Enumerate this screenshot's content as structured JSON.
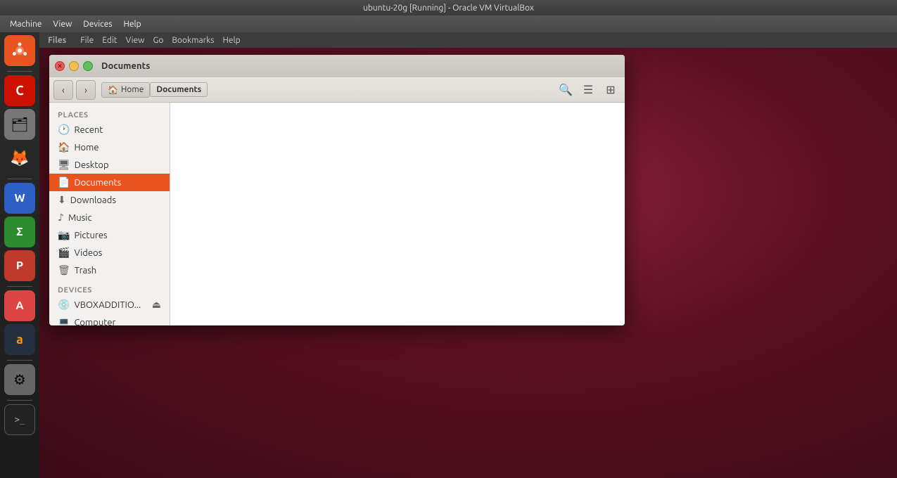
{
  "vbox": {
    "title": "ubuntu-20g [Running] - Oracle VM VirtualBox",
    "menus": [
      "Machine",
      "View",
      "Devices",
      "Help"
    ]
  },
  "files_topbar": {
    "menus": [
      "File",
      "Edit",
      "View",
      "Go",
      "Bookmarks",
      "Help"
    ],
    "left_label": "Files"
  },
  "filemanager": {
    "title": "Documents",
    "toolbar": {
      "back_label": "‹",
      "forward_label": "›",
      "breadcrumb": [
        {
          "label": "Home",
          "icon": "🏠",
          "active": false
        },
        {
          "label": "Documents",
          "icon": "",
          "active": true
        }
      ],
      "search_icon": "🔍",
      "list_icon": "☰",
      "grid_icon": "⋮⋮"
    },
    "sidebar": {
      "places_label": "Places",
      "devices_label": "Devices",
      "places_items": [
        {
          "id": "recent",
          "label": "Recent",
          "icon": "🕐"
        },
        {
          "id": "home",
          "label": "Home",
          "icon": "🏠"
        },
        {
          "id": "desktop",
          "label": "Desktop",
          "icon": "🖥"
        },
        {
          "id": "documents",
          "label": "Documents",
          "icon": "📄",
          "active": true
        },
        {
          "id": "downloads",
          "label": "Downloads",
          "icon": "⬇"
        },
        {
          "id": "music",
          "label": "Music",
          "icon": "♪"
        },
        {
          "id": "pictures",
          "label": "Pictures",
          "icon": "📷"
        },
        {
          "id": "videos",
          "label": "Videos",
          "icon": "🎬"
        },
        {
          "id": "trash",
          "label": "Trash",
          "icon": "🗑"
        }
      ],
      "devices_items": [
        {
          "id": "vboxadditions",
          "label": "VBOXADDITIO...",
          "icon": "💿",
          "eject": true
        },
        {
          "id": "computer",
          "label": "Computer",
          "icon": "💻"
        }
      ]
    }
  },
  "taskbar": {
    "icons": [
      {
        "id": "ubuntu",
        "label": "Ubuntu",
        "symbol": "🔶",
        "color": "#e95420"
      },
      {
        "id": "crimson",
        "label": "Crimson",
        "symbol": "C",
        "color": "#cc1100"
      },
      {
        "id": "files",
        "label": "Files",
        "symbol": "🗂",
        "color": "#888"
      },
      {
        "id": "firefox",
        "label": "Firefox",
        "symbol": "🦊",
        "color": "#ff9900"
      },
      {
        "id": "libreoffice-writer",
        "label": "LibreOffice Writer",
        "symbol": "W",
        "color": "#3455db"
      },
      {
        "id": "libreoffice-calc",
        "label": "LibreOffice Calc",
        "symbol": "Σ",
        "color": "#107c10"
      },
      {
        "id": "libreoffice-impress",
        "label": "LibreOffice Impress",
        "symbol": "P",
        "color": "#c0392b"
      },
      {
        "id": "texteditor",
        "label": "Text Editor",
        "symbol": "A",
        "color": "#e74c3c"
      },
      {
        "id": "amazon",
        "label": "Amazon",
        "symbol": "a",
        "color": "#ff9900"
      },
      {
        "id": "settings",
        "label": "System Settings",
        "symbol": "⚙",
        "color": "#888"
      },
      {
        "id": "terminal",
        "label": "Terminal",
        "symbol": ">_",
        "color": "#2c2c2c"
      }
    ]
  }
}
